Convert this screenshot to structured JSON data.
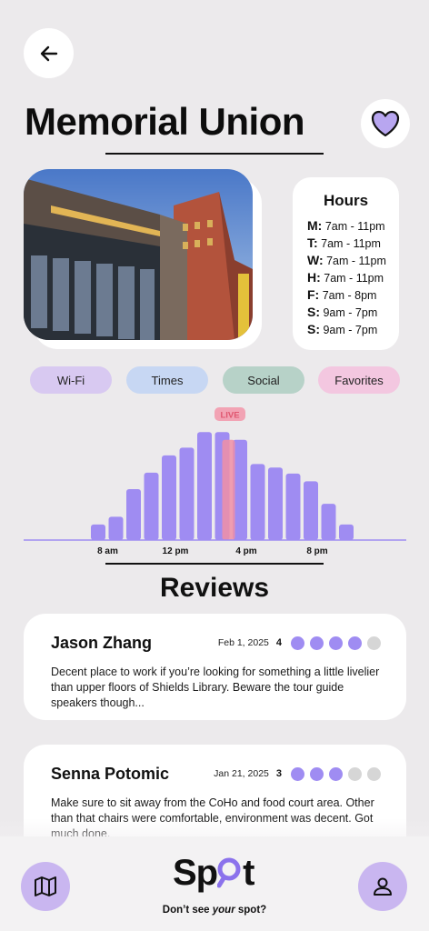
{
  "header": {
    "title": "Memorial Union",
    "back_icon": "arrow-left-icon",
    "favorite_icon": "heart-icon"
  },
  "hours": {
    "title": "Hours",
    "rows": [
      {
        "day": "M:",
        "time": "7am - 11pm"
      },
      {
        "day": "T:",
        "time": "7am - 11pm"
      },
      {
        "day": "W:",
        "time": "7am - 11pm"
      },
      {
        "day": "H:",
        "time": "7am - 11pm"
      },
      {
        "day": "F:",
        "time": "7am - 8pm"
      },
      {
        "day": "S:",
        "time": "9am - 7pm"
      },
      {
        "day": "S:",
        "time": "9am - 7pm"
      }
    ]
  },
  "chips": [
    {
      "label": "Wi-Fi",
      "color": "#d8c9f1"
    },
    {
      "label": "Times",
      "color": "#c7d7f3"
    },
    {
      "label": "Social",
      "color": "#b7d2c8"
    },
    {
      "label": "Favorites",
      "color": "#f3c7e0"
    }
  ],
  "chart_data": {
    "type": "bar",
    "live_label": "LIVE",
    "tick_labels": [
      "8 am",
      "12 pm",
      "4 pm",
      "8 pm"
    ],
    "values": [
      18,
      27,
      59,
      78,
      98,
      107,
      125,
      125,
      116,
      88,
      84,
      77,
      68,
      42,
      18
    ],
    "live_index": 7,
    "live_value": 116,
    "bar_color": "#9f8cf2",
    "live_color": "#f08fa6"
  },
  "reviews": {
    "title": "Reviews",
    "items": [
      {
        "name": "Jason Zhang",
        "date": "Feb 1, 2025",
        "score": "4",
        "rating": 4,
        "text": "Decent place to work if you’re looking for something a little livelier than upper floors of Shields Library. Beware the tour guide speakers though..."
      },
      {
        "name": "Senna Potomic",
        "date": "Jan 21, 2025",
        "score": "3",
        "rating": 3,
        "text": "Make sure to sit away from the CoHo and food court area. Other than that chairs were comfortable, environment was decent. Got much done."
      }
    ]
  },
  "footer": {
    "logo_left": "Sp",
    "logo_right": "t",
    "tagline_before": "Don’t see ",
    "tagline_em": "your",
    "tagline_after": " spot?",
    "map_icon": "map-icon",
    "profile_icon": "user-icon"
  },
  "colors": {
    "accent": "#9f8cf2",
    "accent_light": "#c9b6f0",
    "dot_off": "#d6d6d6"
  }
}
